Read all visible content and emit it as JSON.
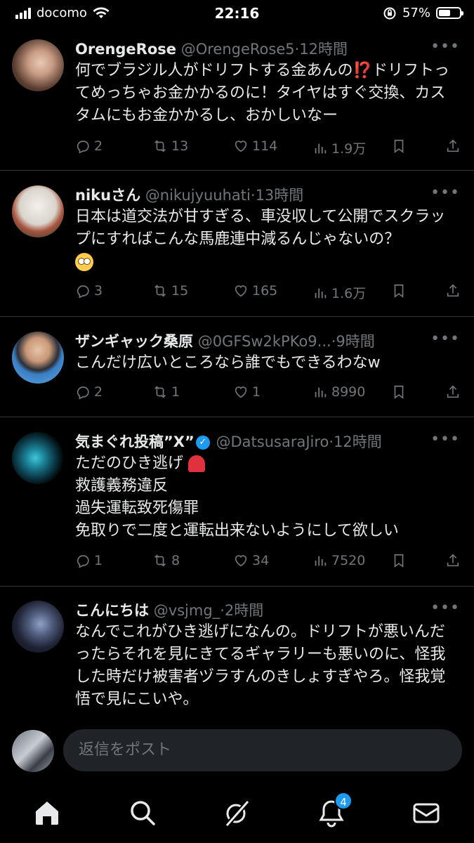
{
  "status_bar": {
    "carrier": "docomo",
    "time": "22:16",
    "battery": "57%",
    "battery_level": 0.57
  },
  "tweets": [
    {
      "name": "OrengeRose",
      "handle": "@OrengeRose5",
      "time": "12時間",
      "text_before": "何でブラジル人がドリフトする金あんの",
      "emoji": "⁉️",
      "text_after": "ドリフトってめっちゃお金かかるのに！タイヤはすぐ交換、カスタムにもお金かかるし、おかしいなー",
      "replies": "2",
      "reposts": "13",
      "likes": "114",
      "views": "1.9万"
    },
    {
      "name": "nikuさん",
      "handle": "@nikujyuuhati",
      "time": "13時間",
      "text": "日本は道交法が甘すぎる、車没収して公開でスクラップにすればこんな馬鹿連中減るんじゃないの？",
      "replies": "3",
      "reposts": "15",
      "likes": "165",
      "views": "1.6万"
    },
    {
      "name": "ザンギャック桑原",
      "handle": "@0GFSw2kPKo9...",
      "time": "9時間",
      "text": "こんだけ広いところなら誰でもできるわなw",
      "replies": "2",
      "reposts": "1",
      "likes": "1",
      "views": "8990"
    },
    {
      "name": "気まぐれ投稿”X”",
      "handle": "@DatsusaraJiro",
      "time": "12時間",
      "line1": "ただのひき逃げ",
      "line2": "救護義務違反",
      "line3": "過失運転致死傷罪",
      "line4": "免取りで二度と運転出来ないようにして欲しい",
      "replies": "1",
      "reposts": "8",
      "likes": "34",
      "views": "7520"
    },
    {
      "name": "こんにちは",
      "handle": "@vsjmg_",
      "time": "2時間",
      "text": "なんでこれがひき逃げになんの。ドリフトが悪いんだったらそれを見にきてるギャラリーも悪いのに、怪我した時だけ被害者ヅラすんのきしょすぎやろ。怪我覚悟で見にこいや。"
    }
  ],
  "reply_bar": {
    "placeholder": "返信をポスト"
  },
  "tab_bar": {
    "notifications_badge": "4"
  },
  "colors": {
    "background": "#000000",
    "accent": "#1d9bf0",
    "muted": "#71767b",
    "divider": "#2f3336"
  }
}
